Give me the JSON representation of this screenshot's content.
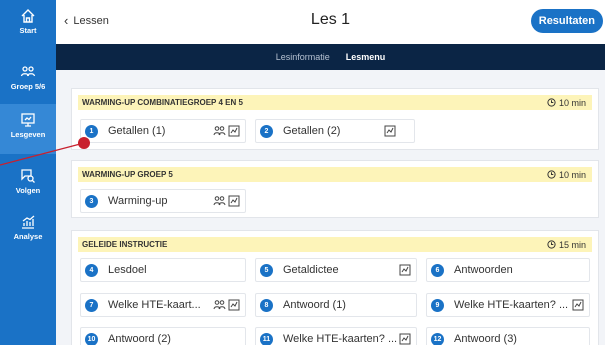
{
  "sidebar": {
    "items": [
      {
        "label": "Start",
        "icon": "home-icon"
      },
      {
        "label": "Groep 5/6",
        "icon": "group-icon"
      },
      {
        "label": "Lesgeven",
        "icon": "presentation-icon",
        "active": true
      },
      {
        "label": "Volgen",
        "icon": "chat-search-icon"
      },
      {
        "label": "Analyse",
        "icon": "chart-icon"
      }
    ]
  },
  "header": {
    "back_label": "Lessen",
    "title": "Les 1",
    "results_label": "Resultaten"
  },
  "subnav": {
    "tabs": [
      {
        "label": "Lesinformatie",
        "active": false
      },
      {
        "label": "Lesmenu",
        "active": true
      }
    ]
  },
  "sections": [
    {
      "title": "WARMING-UP COMBINATIEGROEP 4 EN 5",
      "time": "10 min",
      "items": [
        {
          "num": "1",
          "label": "Getallen (1)",
          "icons": [
            "group-icon",
            "board-icon"
          ]
        },
        {
          "num": "2",
          "label": "Getallen (2)",
          "icons": [
            "board-icon"
          ]
        }
      ]
    },
    {
      "title": "WARMING-UP GROEP 5",
      "time": "10 min",
      "items": [
        {
          "num": "3",
          "label": "Warming-up",
          "icons": [
            "group-icon",
            "board-icon"
          ]
        }
      ]
    },
    {
      "title": "GELEIDE INSTRUCTIE",
      "time": "15 min",
      "items": [
        {
          "num": "4",
          "label": "Lesdoel",
          "icons": []
        },
        {
          "num": "5",
          "label": "Getaldictee",
          "icons": [
            "board-icon"
          ]
        },
        {
          "num": "6",
          "label": "Antwoorden",
          "icons": []
        },
        {
          "num": "7",
          "label": "Welke HTE-kaart...",
          "icons": [
            "group-icon",
            "board-icon"
          ]
        },
        {
          "num": "8",
          "label": "Antwoord (1)",
          "icons": []
        },
        {
          "num": "9",
          "label": "Welke HTE-kaarten? ...",
          "icons": [
            "board-icon"
          ]
        },
        {
          "num": "10",
          "label": "Antwoord (2)",
          "icons": []
        },
        {
          "num": "11",
          "label": "Welke HTE-kaarten? ...",
          "icons": [
            "board-icon"
          ]
        },
        {
          "num": "12",
          "label": "Antwoord (3)",
          "icons": []
        }
      ]
    }
  ],
  "colors": {
    "brand": "#1a72c6",
    "subnav": "#0b2545",
    "section_head": "#fdf4b9",
    "annotation": "#c8202e"
  }
}
